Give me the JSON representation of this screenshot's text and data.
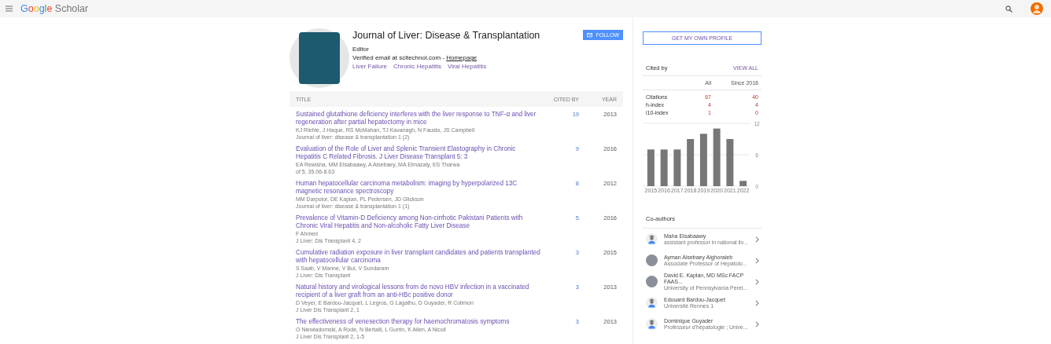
{
  "header": {
    "logo": {
      "brand": "Google",
      "product": "Scholar"
    }
  },
  "profile": {
    "name": "Journal of Liver: Disease & Transplantation",
    "affiliation": "Editor",
    "email": "Verified email at scitechnol.com -",
    "homepage": "Homepage",
    "interests": [
      "Liver Failure",
      "Chronic Hepatitis",
      "Viral Hepatitis"
    ],
    "follow_button": "FOLLOW"
  },
  "table": {
    "columns": [
      "TITLE",
      "CITED BY",
      "YEAR"
    ],
    "rows": [
      {
        "title": "Sustained glutathione deficiency interferes with the liver response to TNF-α and liver regeneration after partial hepatectomy in mice",
        "authors": "KJ Riehle, J Haque, RS McMahan, TJ Kavanagh, N Fausto, JS Campbell",
        "source": "Journal of liver: disease & transplantation 1 (2)",
        "cited_by": "19",
        "year": "2013"
      },
      {
        "title": "Evaluation of the Role of Liver and Splenic Transient Elastography in Chronic Hepatitis C Related Fibrosis. J Liver Disease Transplant 5: 3",
        "authors": "EA Rewisha, MM Elsabaawy, A Alsebaey, MA Elmazaly, ES Tharwa",
        "source": "of 5, 35.06-8.63",
        "cited_by": "9",
        "year": "2016"
      },
      {
        "title": "Human hepatocellular carcinoma metabolism: imaging by hyperpolarized 13C magnetic resonance spectroscopy",
        "authors": "MM Darpolor, DE Kaplan, PL Pedersen, JD Glickson",
        "source": "Journal of liver: disease & transplantation 1 (1)",
        "cited_by": "8",
        "year": "2012"
      },
      {
        "title": "Prevalence of Vitamin-D Deficiency among Non-cirrhotic Pakistani Patients with Chronic Viral Hepatitis and Non-alcoholic Fatty Liver Disease",
        "authors": "F Ahmed",
        "source": "J Liver: Dis Transplant 4, 2",
        "cited_by": "5",
        "year": "2016"
      },
      {
        "title": "Cumulative radiation exposure in liver transplant candidates and patients transplanted with hepatocellular carcinoma",
        "authors": "S Saab, V Manne, V Bui, V Sundaram",
        "source": "J Liver: Dis Transplant",
        "cited_by": "3",
        "year": "2015"
      },
      {
        "title": "Natural history and virological lessons from de novo HBV infection in a vaccinated recipient of a liver graft from an anti-HBc positive donor",
        "authors": "D Veyer, E Bardou-Jacquet, L Legros, G Lagathu, D Guyader, R Colimon",
        "source": "J Liver Dis Transplant 2, 1",
        "cited_by": "3",
        "year": "2013"
      },
      {
        "title": "The effectiveness of venesection therapy for haemochromatosis symptoms",
        "authors": "O Niewiadomski, A Rode, N Bertalli, L Gurrin, K Allen, A Nicoll",
        "source": "J Liver Dis Transplant 2, 1-5",
        "cited_by": "3",
        "year": "2013"
      }
    ]
  },
  "sidebar": {
    "profile_button": "GET MY OWN PROFILE",
    "cited_by": {
      "title": "Cited by",
      "view_all": "VIEW ALL",
      "columns": [
        "All",
        "Since 2018"
      ],
      "rows": [
        {
          "label": "Citations",
          "all": "67",
          "since": "40"
        },
        {
          "label": "h-index",
          "all": "4",
          "since": "4"
        },
        {
          "label": "i10-index",
          "all": "1",
          "since": "0"
        }
      ],
      "chart_data": {
        "type": "bar",
        "categories": [
          "2015",
          "2016",
          "2017",
          "2018",
          "2019",
          "2020",
          "2021",
          "2022"
        ],
        "values": [
          7,
          7,
          7,
          9,
          10,
          11,
          9,
          1
        ],
        "ylim": [
          0,
          12
        ],
        "yticks": [
          0,
          6,
          12
        ]
      }
    },
    "coauthors": {
      "title": "Co-authors",
      "items": [
        {
          "name": "Maha Elsabaawy",
          "detail": "assistant professor in national liv...",
          "kind": "silhouette"
        },
        {
          "name": "Ayman Alsebaey Alghoraieb",
          "detail": "Associate Professor of Hepatolo...",
          "kind": "photo"
        },
        {
          "name": "David E. Kaplan, MD MSc FACP FAAS...",
          "detail": "University of Pennsylvania Perel...",
          "kind": "photo"
        },
        {
          "name": "Edouard Bardou-Jacquet",
          "detail": "Université Rennes 1",
          "kind": "silhouette"
        },
        {
          "name": "Dominique Guyader",
          "detail": "Professeur d'hépatologie ; Unive...",
          "kind": "silhouette"
        }
      ]
    }
  }
}
